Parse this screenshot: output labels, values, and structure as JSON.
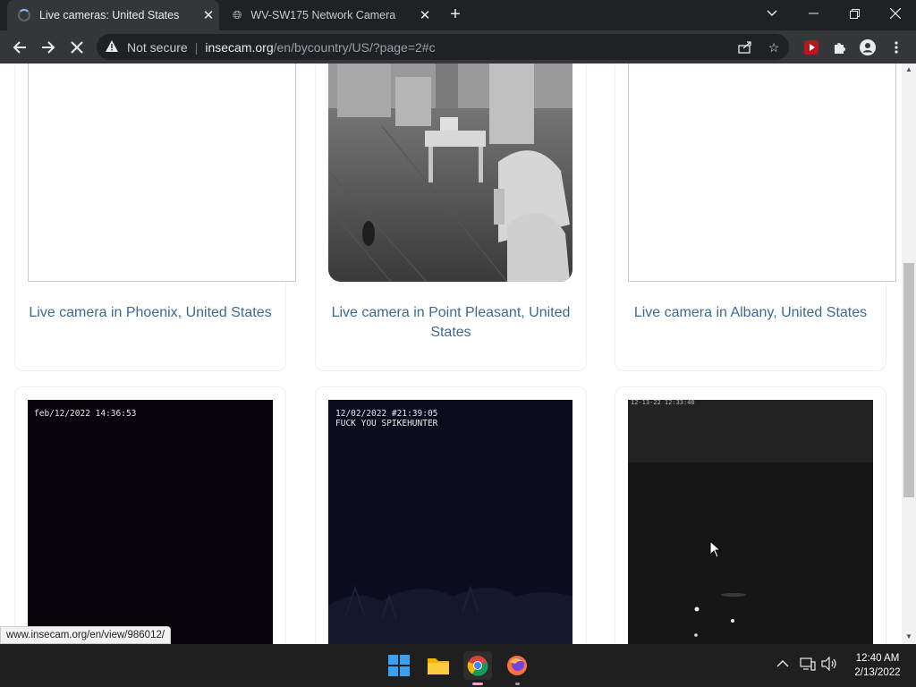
{
  "browser": {
    "tabs": [
      {
        "title": "Live cameras: United States",
        "active": true
      },
      {
        "title": "WV-SW175 Network Camera",
        "active": false
      }
    ],
    "address": {
      "security_label": "Not secure",
      "host": "insecam.org",
      "path": "/en/bycountry/US/?page=2#c"
    },
    "status_url": "www.insecam.org/en/view/986012/"
  },
  "cameras": [
    {
      "caption": "Live camera in Phoenix, United States"
    },
    {
      "caption": "Live camera in Point Pleasant, United States"
    },
    {
      "caption": "Live camera in Albany, United States"
    },
    {
      "overlay_text": "feb/12/2022  14:36:53"
    },
    {
      "overlay_text": "12/02/2022 #21:39:05",
      "overlay_text_2": "FUCK YOU SPIKEHUNTER"
    },
    {
      "overlay_text": "12-13-22 12:33:40"
    }
  ],
  "taskbar": {
    "time": "12:40 AM",
    "date": "2/13/2022"
  },
  "colors": {
    "link": "#3d6a94",
    "chrome_dark": "#202124",
    "toolbar": "#35363a"
  }
}
